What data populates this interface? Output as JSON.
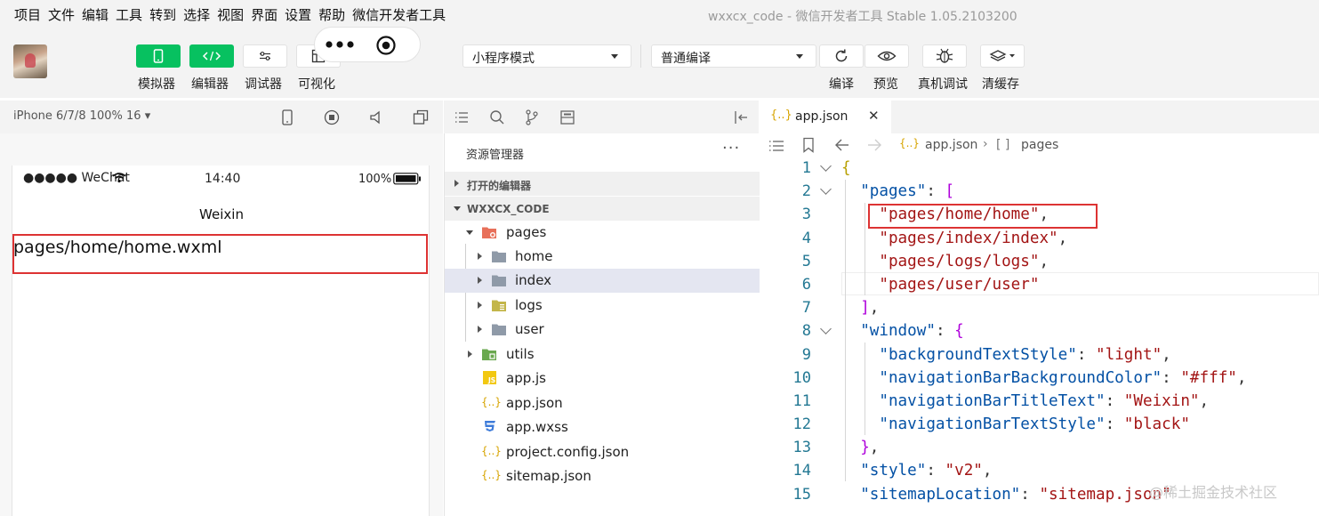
{
  "menu": [
    "项目",
    "文件",
    "编辑",
    "工具",
    "转到",
    "选择",
    "视图",
    "界面",
    "设置",
    "帮助",
    "微信开发者工具"
  ],
  "window_title": "wxxcx_code - 微信开发者工具 Stable 1.05.2103200",
  "toolbar": {
    "simulator": "模拟器",
    "editor": "编辑器",
    "debugger": "调试器",
    "visual": "可视化",
    "mode_select": "小程序模式",
    "compile_select": "普通编译",
    "compile": "编译",
    "preview": "预览",
    "real_debug": "真机调试",
    "clear_cache": "清缓存"
  },
  "simulator": {
    "device": "iPhone 6/7/8 100% 16 ▾",
    "carrier": "●●●●● WeChat",
    "time": "14:40",
    "battery": "100%",
    "nav_title": "Weixin",
    "page_text": "pages/home/home.wxml"
  },
  "explorer": {
    "title": "资源管理器",
    "more": "···",
    "open_editors": "打开的编辑器",
    "project": "WXXCX_CODE",
    "tree": {
      "pages": "pages",
      "home": "home",
      "index": "index",
      "logs": "logs",
      "user": "user",
      "utils": "utils",
      "app_js": "app.js",
      "app_json": "app.json",
      "app_wxss": "app.wxss",
      "project_config": "project.config.json",
      "sitemap": "sitemap.json"
    }
  },
  "editor": {
    "tab_label": "app.json",
    "tab_close": "✕",
    "breadcrumb_file": "app.json",
    "breadcrumb_sep": "›",
    "breadcrumb_array": "[ ]",
    "breadcrumb_key": "pages",
    "code": {
      "l1_open": "{",
      "pages_key": "\"pages\"",
      "p1": "\"pages/home/home\"",
      "p2": "\"pages/index/index\"",
      "p3": "\"pages/logs/logs\"",
      "p4": "\"pages/user/user\"",
      "window_key": "\"window\"",
      "bg_key": "\"backgroundTextStyle\"",
      "bg_val": "\"light\"",
      "nbc_key": "\"navigationBarBackgroundColor\"",
      "nbc_val": "\"#fff\"",
      "nbt_key": "\"navigationBarTitleText\"",
      "nbt_val": "\"Weixin\"",
      "nts_key": "\"navigationBarTextStyle\"",
      "nts_val": "\"black\"",
      "style_key": "\"style\"",
      "style_val": "\"v2\"",
      "sitemap_key": "\"sitemapLocation\"",
      "sitemap_val": "\"sitemap.json\""
    }
  },
  "watermark": "@稀土掘金技术社区",
  "colors": {
    "accent_green": "#07c160",
    "highlight_red": "#dd3333",
    "json_key": "#0451a5",
    "json_string": "#a31515"
  }
}
